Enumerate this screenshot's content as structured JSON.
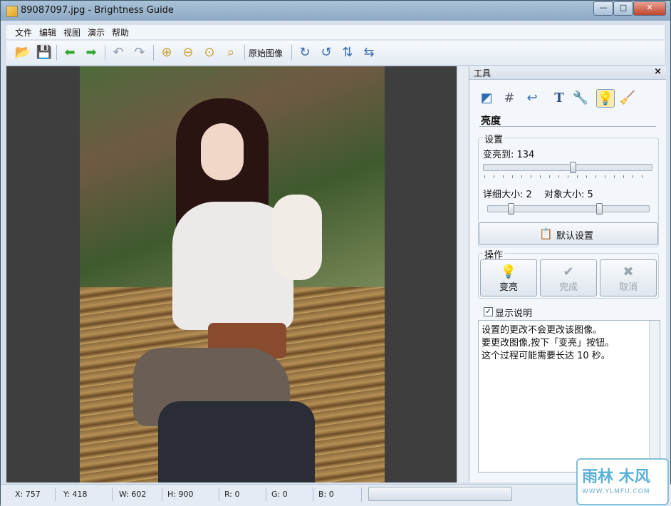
{
  "window": {
    "title": "89087097.jpg - Brightness Guide",
    "min": "—",
    "max": "□",
    "close": "✕"
  },
  "menu": [
    "文件",
    "编辑",
    "视图",
    "演示",
    "帮助"
  ],
  "toolbar": {
    "original_image_label": "原始图像"
  },
  "panel": {
    "tab_label": "工具",
    "close": "×",
    "section_title": "亮度",
    "settings": {
      "legend": "设置",
      "brighten_label": "变亮到: 134",
      "brighten_value": 134,
      "brighten_max": 255,
      "detail_label": "详细大小: 2",
      "detail_value": 2,
      "object_label": "对象大小: 5",
      "object_value": 5,
      "defaults_button": "默认设置"
    },
    "ops": {
      "legend": "操作",
      "buttons": [
        {
          "label": "变亮",
          "icon": "bulb-icon",
          "glyph": "💡",
          "enabled": true
        },
        {
          "label": "完成",
          "icon": "check-icon",
          "glyph": "✔",
          "enabled": false
        },
        {
          "label": "取消",
          "icon": "x-icon",
          "glyph": "✖",
          "enabled": false
        }
      ]
    },
    "show_notes_label": "显示说明",
    "show_notes_checked": true,
    "notes": [
      "设置的更改不会更改该图像。",
      "要更改图像,按下「变亮」按钮。",
      "这个过程可能需要长达 10 秒。"
    ]
  },
  "status": {
    "x": "X: 757",
    "y": "Y: 418",
    "w": "W: 602",
    "h": "H: 900",
    "r": "R: 0",
    "g": "G: 0",
    "b": "B: 0"
  },
  "watermark": {
    "brand": "雨林 木风",
    "url": "WWW.YLMFU.COM"
  }
}
